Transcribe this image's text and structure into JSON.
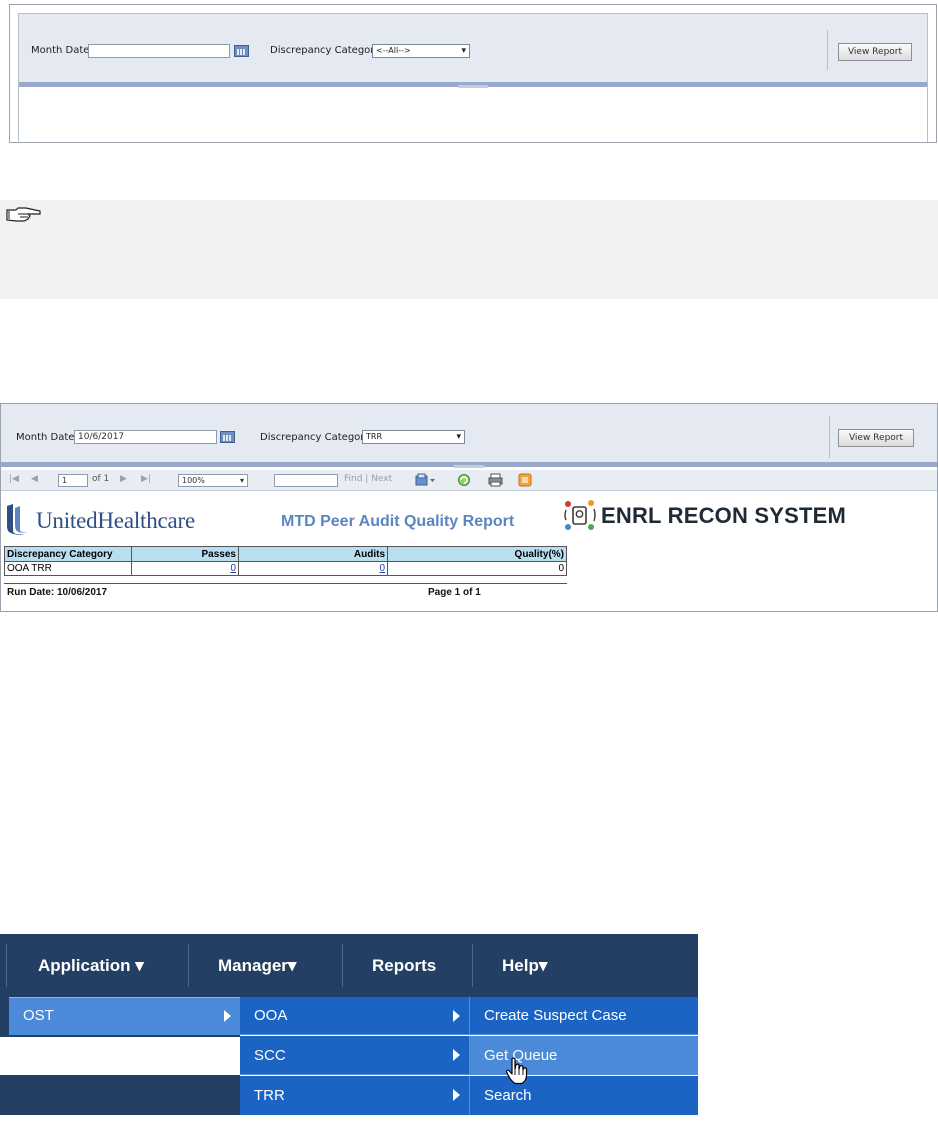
{
  "panel1": {
    "month_date_label": "Month Date",
    "month_date_value": "",
    "discrepancy_label": "Discrepancy Category",
    "discrepancy_value": "<--All-->",
    "view_report_label": "View Report"
  },
  "panel3": {
    "month_date_label": "Month Date",
    "month_date_value": "10/6/2017",
    "discrepancy_label": "Discrepancy Category",
    "discrepancy_value": "TRR",
    "view_report_label": "View Report",
    "toolbar": {
      "first": "|◀",
      "prev": "◀",
      "page_value": "1",
      "of_pages": "of 1",
      "next": "▶",
      "last": "▶|",
      "zoom": "100%",
      "find_value": "",
      "find_next": "Find | Next"
    },
    "report": {
      "company": "UnitedHealthcare",
      "title": "MTD Peer Audit Quality Report",
      "system": "ENRL RECON SYSTEM",
      "columns": [
        "Discrepancy Category",
        "Passes",
        "Audits",
        "Quality(%)"
      ],
      "rows": [
        {
          "category": "OOA TRR",
          "passes": "0",
          "audits": "0",
          "quality": "0"
        }
      ],
      "run_date": "Run Date: 10/06/2017",
      "page_info": "Page 1 of 1"
    }
  },
  "menu": {
    "top": [
      {
        "label": "Application ▾"
      },
      {
        "label": "Manager▾"
      },
      {
        "label": "Reports"
      },
      {
        "label": "Help▾"
      }
    ],
    "level1": [
      {
        "label": "OST"
      }
    ],
    "level2": [
      {
        "label": "OOA"
      },
      {
        "label": "SCC"
      },
      {
        "label": "TRR"
      }
    ],
    "level3": [
      {
        "label": "Create Suspect Case"
      },
      {
        "label": "Get Queue"
      },
      {
        "label": "Search"
      }
    ]
  },
  "colors": {
    "menu_bg": "#233f63",
    "menu_dropdown": "#1c64c4",
    "menu_hover": "#4a8ad8",
    "param_bar": "#e4e9f2",
    "table_header": "#b9def0"
  }
}
